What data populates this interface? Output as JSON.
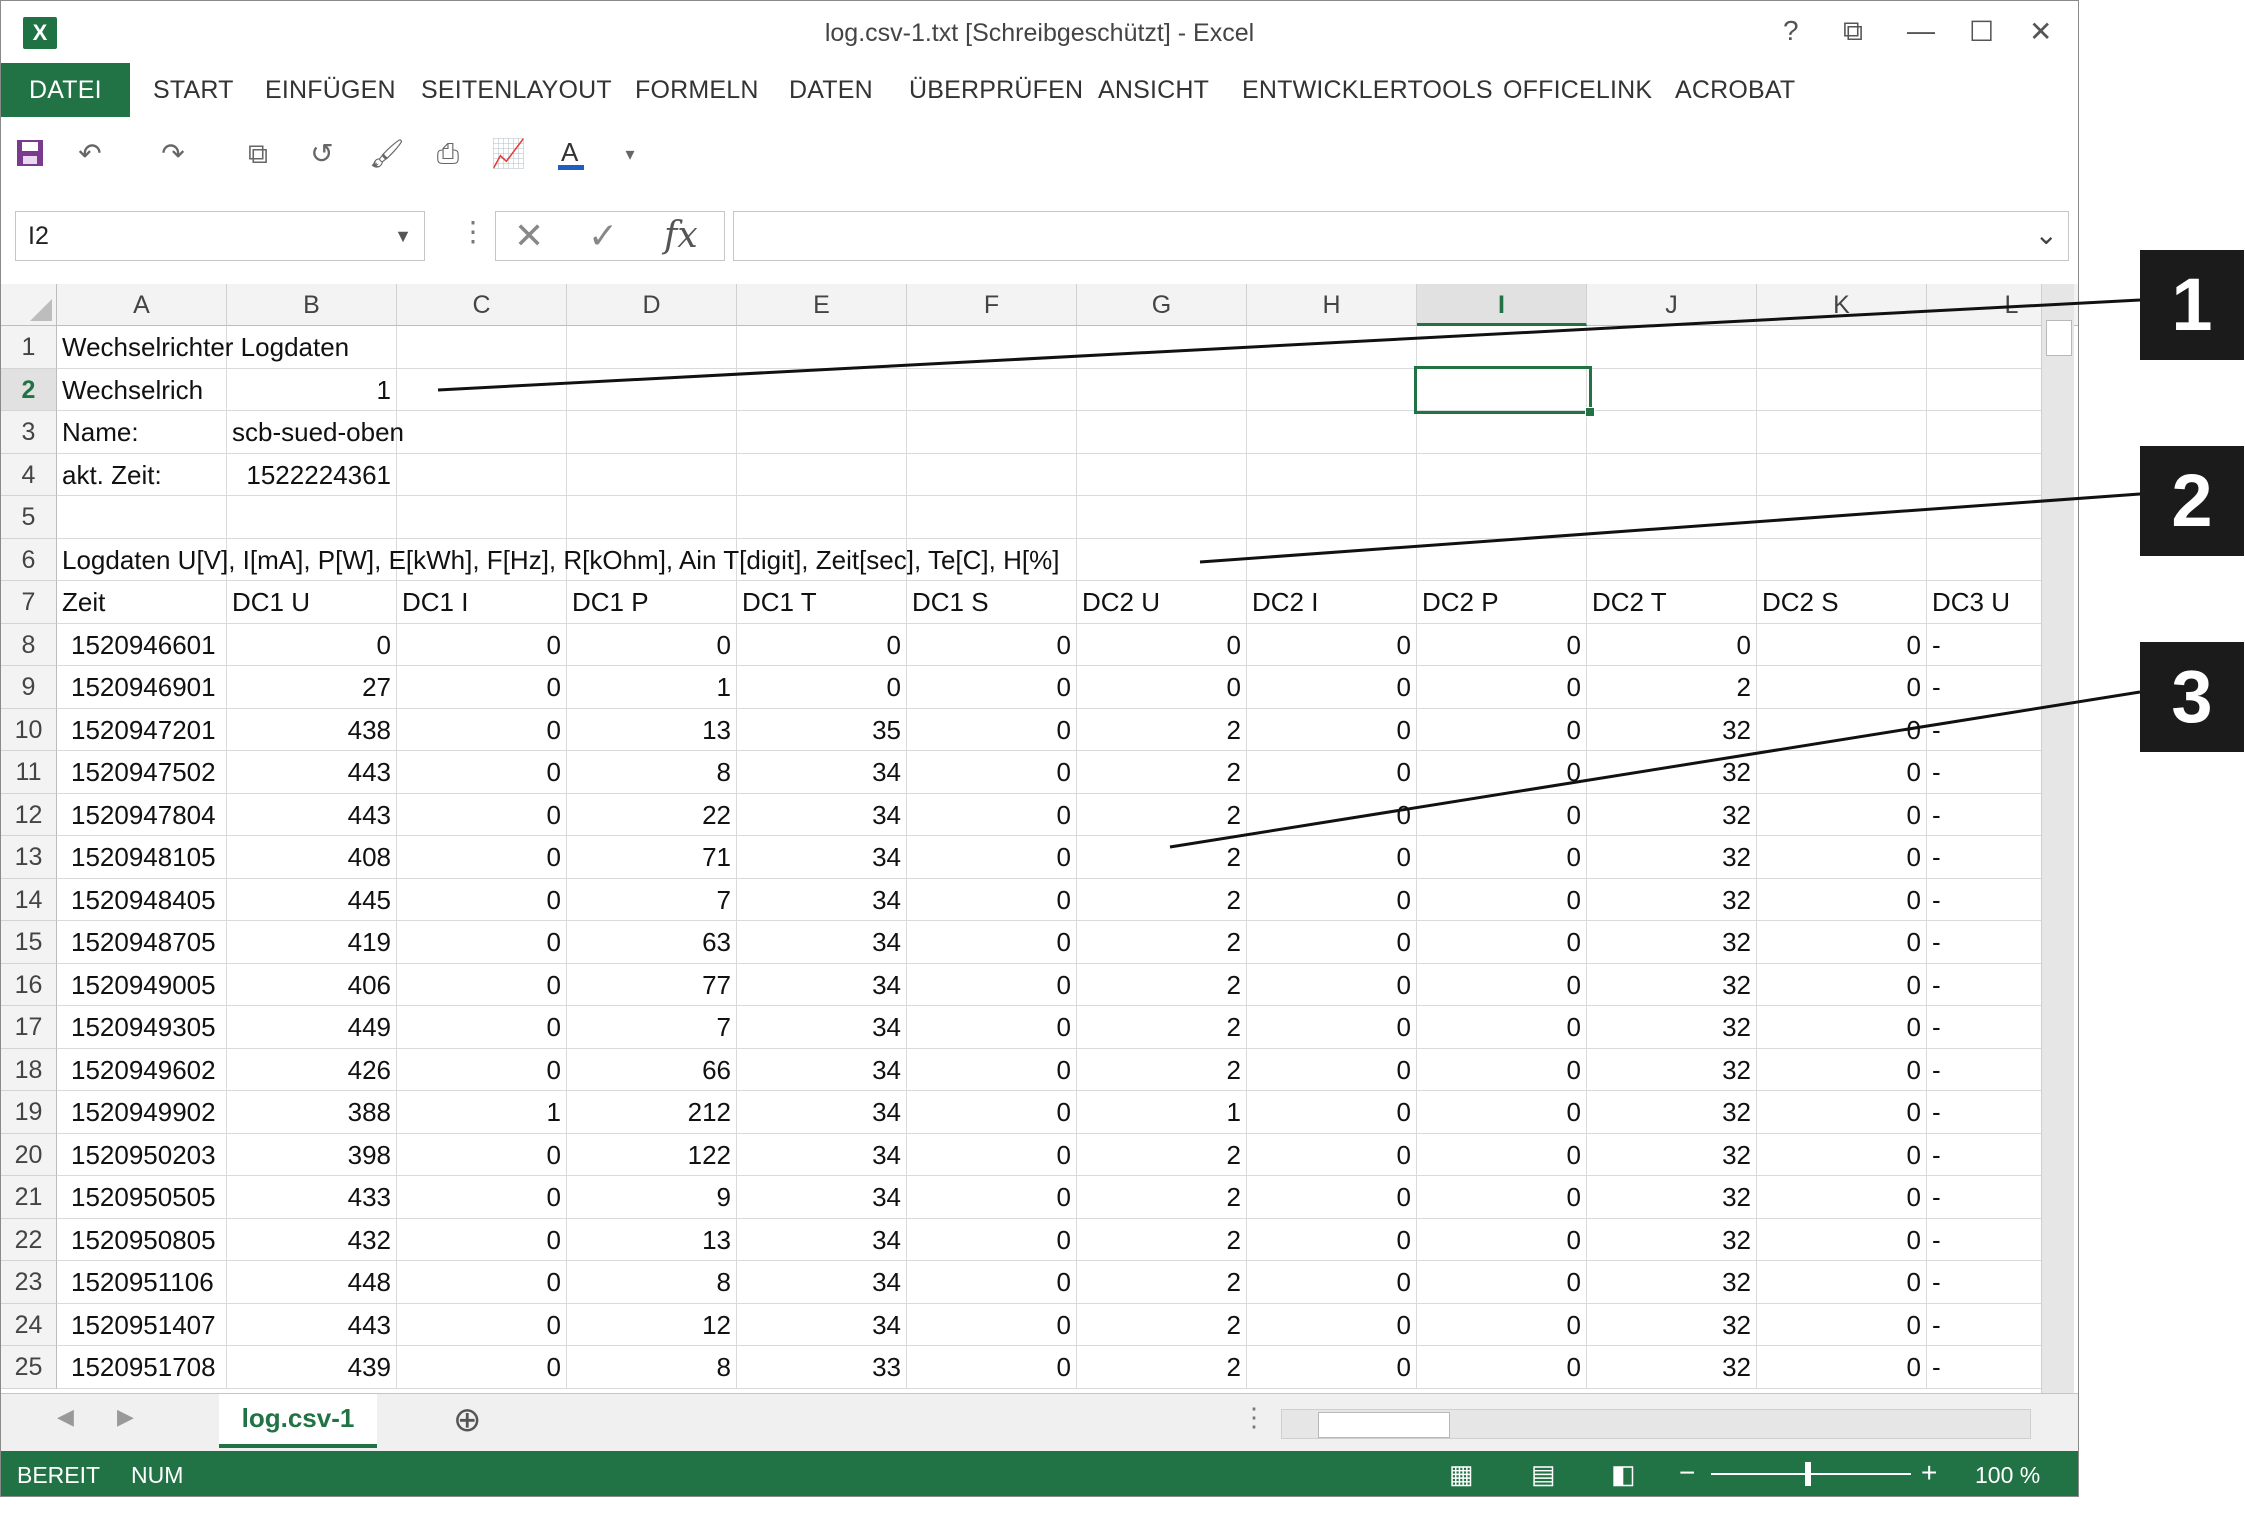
{
  "window": {
    "title": "log.csv-1.txt  [Schreibgeschützt] - Excel",
    "app_icon": "X",
    "controls": [
      "?",
      "⧉",
      "—",
      "☐",
      "✕"
    ]
  },
  "ribbon": {
    "tabs": [
      "DATEI",
      "START",
      "EINFÜGEN",
      "SEITENLAYOUT",
      "FORMELN",
      "DATEN",
      "ÜBERPRÜFEN",
      "ANSICHT",
      "ENTWICKLERTOOLS",
      "OFFICELINK",
      "ACROBAT"
    ],
    "active_tab": "DATEI"
  },
  "quick_access": [
    "save-icon",
    "undo-icon",
    "redo-icon",
    "copy-icon",
    "refresh-icon",
    "format-painter-icon",
    "print-icon",
    "chart-icon",
    "font-color-icon",
    "customize-icon"
  ],
  "formula_bar": {
    "name_box": "I2",
    "formula": "",
    "fx_label": "fx"
  },
  "columns": [
    "A",
    "B",
    "C",
    "D",
    "E",
    "F",
    "G",
    "H",
    "I",
    "J",
    "K",
    "L"
  ],
  "selected_column": "I",
  "selected_row": 2,
  "rows": [
    1,
    2,
    3,
    4,
    5,
    6,
    7,
    8,
    9,
    10,
    11,
    12,
    13,
    14,
    15,
    16,
    17,
    18,
    19,
    20,
    21,
    22,
    23,
    24,
    25
  ],
  "header_block": {
    "r1": "Wechselrichter Logdaten",
    "r2_label": "Wechselrich",
    "r2_value": "1",
    "r3_label": "Name:",
    "r3_value": "scb-sued-oben",
    "r4_label": "akt. Zeit:",
    "r4_value": "1522224361",
    "r6": "Logdaten U[V], I[mA], P[W], E[kWh], F[Hz], R[kOhm], Ain T[digit], Zeit[sec], Te[C], H[%]"
  },
  "table_headers": [
    "Zeit",
    "DC1 U",
    "DC1 I",
    "DC1 P",
    "DC1 T",
    "DC1 S",
    "DC2 U",
    "DC2 I",
    "DC2 P",
    "DC2 T",
    "DC2 S",
    "DC3 U"
  ],
  "table_rows": [
    [
      "1520946601",
      "0",
      "0",
      "0",
      "0",
      "0",
      "0",
      "0",
      "0",
      "0",
      "0",
      "-"
    ],
    [
      "1520946901",
      "27",
      "0",
      "1",
      "0",
      "0",
      "0",
      "0",
      "0",
      "2",
      "0",
      "-"
    ],
    [
      "1520947201",
      "438",
      "0",
      "13",
      "35",
      "0",
      "2",
      "0",
      "0",
      "32",
      "0",
      "-"
    ],
    [
      "1520947502",
      "443",
      "0",
      "8",
      "34",
      "0",
      "2",
      "0",
      "0",
      "32",
      "0",
      "-"
    ],
    [
      "1520947804",
      "443",
      "0",
      "22",
      "34",
      "0",
      "2",
      "0",
      "0",
      "32",
      "0",
      "-"
    ],
    [
      "1520948105",
      "408",
      "0",
      "71",
      "34",
      "0",
      "2",
      "0",
      "0",
      "32",
      "0",
      "-"
    ],
    [
      "1520948405",
      "445",
      "0",
      "7",
      "34",
      "0",
      "2",
      "0",
      "0",
      "32",
      "0",
      "-"
    ],
    [
      "1520948705",
      "419",
      "0",
      "63",
      "34",
      "0",
      "2",
      "0",
      "0",
      "32",
      "0",
      "-"
    ],
    [
      "1520949005",
      "406",
      "0",
      "77",
      "34",
      "0",
      "2",
      "0",
      "0",
      "32",
      "0",
      "-"
    ],
    [
      "1520949305",
      "449",
      "0",
      "7",
      "34",
      "0",
      "2",
      "0",
      "0",
      "32",
      "0",
      "-"
    ],
    [
      "1520949602",
      "426",
      "0",
      "66",
      "34",
      "0",
      "2",
      "0",
      "0",
      "32",
      "0",
      "-"
    ],
    [
      "1520949902",
      "388",
      "1",
      "212",
      "34",
      "0",
      "1",
      "0",
      "0",
      "32",
      "0",
      "-"
    ],
    [
      "1520950203",
      "398",
      "0",
      "122",
      "34",
      "0",
      "2",
      "0",
      "0",
      "32",
      "0",
      "-"
    ],
    [
      "1520950505",
      "433",
      "0",
      "9",
      "34",
      "0",
      "2",
      "0",
      "0",
      "32",
      "0",
      "-"
    ],
    [
      "1520950805",
      "432",
      "0",
      "13",
      "34",
      "0",
      "2",
      "0",
      "0",
      "32",
      "0",
      "-"
    ],
    [
      "1520951106",
      "448",
      "0",
      "8",
      "34",
      "0",
      "2",
      "0",
      "0",
      "32",
      "0",
      "-"
    ],
    [
      "1520951407",
      "443",
      "0",
      "12",
      "34",
      "0",
      "2",
      "0",
      "0",
      "32",
      "0",
      "-"
    ],
    [
      "1520951708",
      "439",
      "0",
      "8",
      "33",
      "0",
      "2",
      "0",
      "0",
      "32",
      "0",
      "-"
    ]
  ],
  "sheet_tabs": [
    "log.csv-1"
  ],
  "status_bar": {
    "left": [
      "BEREIT",
      "NUM"
    ],
    "zoom": "100 %"
  },
  "callouts": [
    "1",
    "2",
    "3"
  ],
  "colors": {
    "accent": "#217346",
    "callout_bg": "#1b1b1b"
  }
}
